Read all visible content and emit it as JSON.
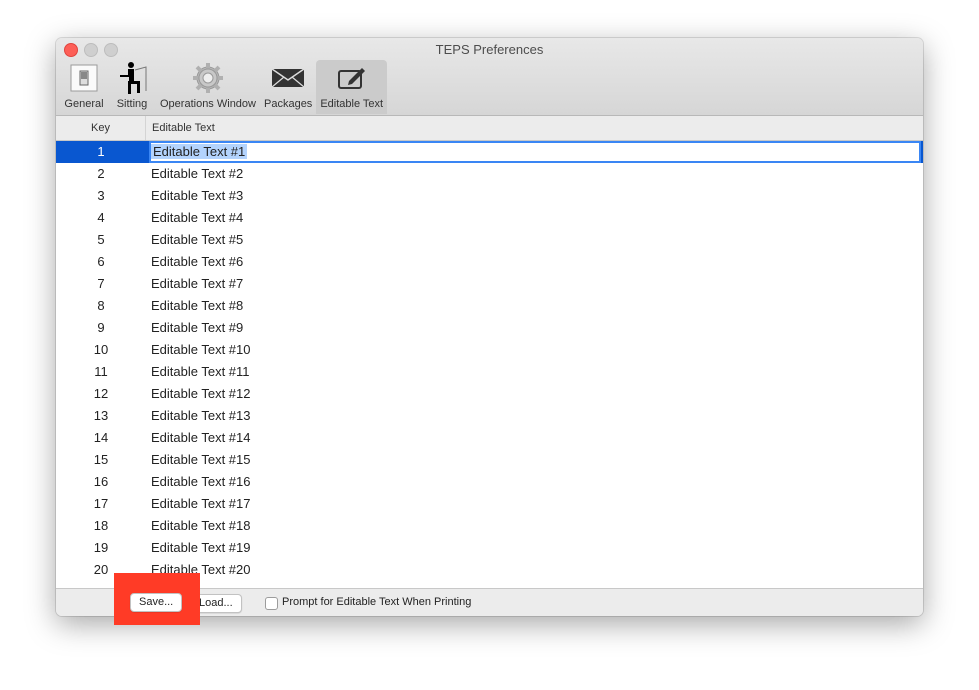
{
  "window": {
    "title": "TEPS Preferences"
  },
  "toolbar": {
    "items": [
      {
        "label": "General",
        "icon": "switch-icon",
        "active": false
      },
      {
        "label": "Sitting",
        "icon": "person-sitting-icon",
        "active": false
      },
      {
        "label": "Operations Window",
        "icon": "gear-icon",
        "active": false
      },
      {
        "label": "Packages",
        "icon": "envelope-icon",
        "active": false
      },
      {
        "label": "Editable Text",
        "icon": "edit-icon",
        "active": true
      }
    ]
  },
  "table": {
    "columns": [
      "Key",
      "Editable Text"
    ],
    "rows": [
      {
        "key": "1",
        "text": "Editable Text #1",
        "selected": true
      },
      {
        "key": "2",
        "text": "Editable Text #2"
      },
      {
        "key": "3",
        "text": "Editable Text #3"
      },
      {
        "key": "4",
        "text": "Editable Text #4"
      },
      {
        "key": "5",
        "text": "Editable Text #5"
      },
      {
        "key": "6",
        "text": "Editable Text #6"
      },
      {
        "key": "7",
        "text": "Editable Text #7"
      },
      {
        "key": "8",
        "text": "Editable Text #8"
      },
      {
        "key": "9",
        "text": "Editable Text #9"
      },
      {
        "key": "10",
        "text": "Editable Text #10"
      },
      {
        "key": "11",
        "text": "Editable Text #11"
      },
      {
        "key": "12",
        "text": "Editable Text #12"
      },
      {
        "key": "13",
        "text": "Editable Text #13"
      },
      {
        "key": "14",
        "text": "Editable Text #14"
      },
      {
        "key": "15",
        "text": "Editable Text #15"
      },
      {
        "key": "16",
        "text": "Editable Text #16"
      },
      {
        "key": "17",
        "text": "Editable Text #17"
      },
      {
        "key": "18",
        "text": "Editable Text #18"
      },
      {
        "key": "19",
        "text": "Editable Text #19"
      },
      {
        "key": "20",
        "text": "Editable Text #20"
      }
    ]
  },
  "bottom": {
    "save_label": "Save...",
    "load_label": "Load...",
    "prompt_label": "Prompt for Editable Text When Printing",
    "prompt_checked": false
  },
  "colors": {
    "selection": "#0957d0",
    "highlight": "#ff3b26"
  }
}
